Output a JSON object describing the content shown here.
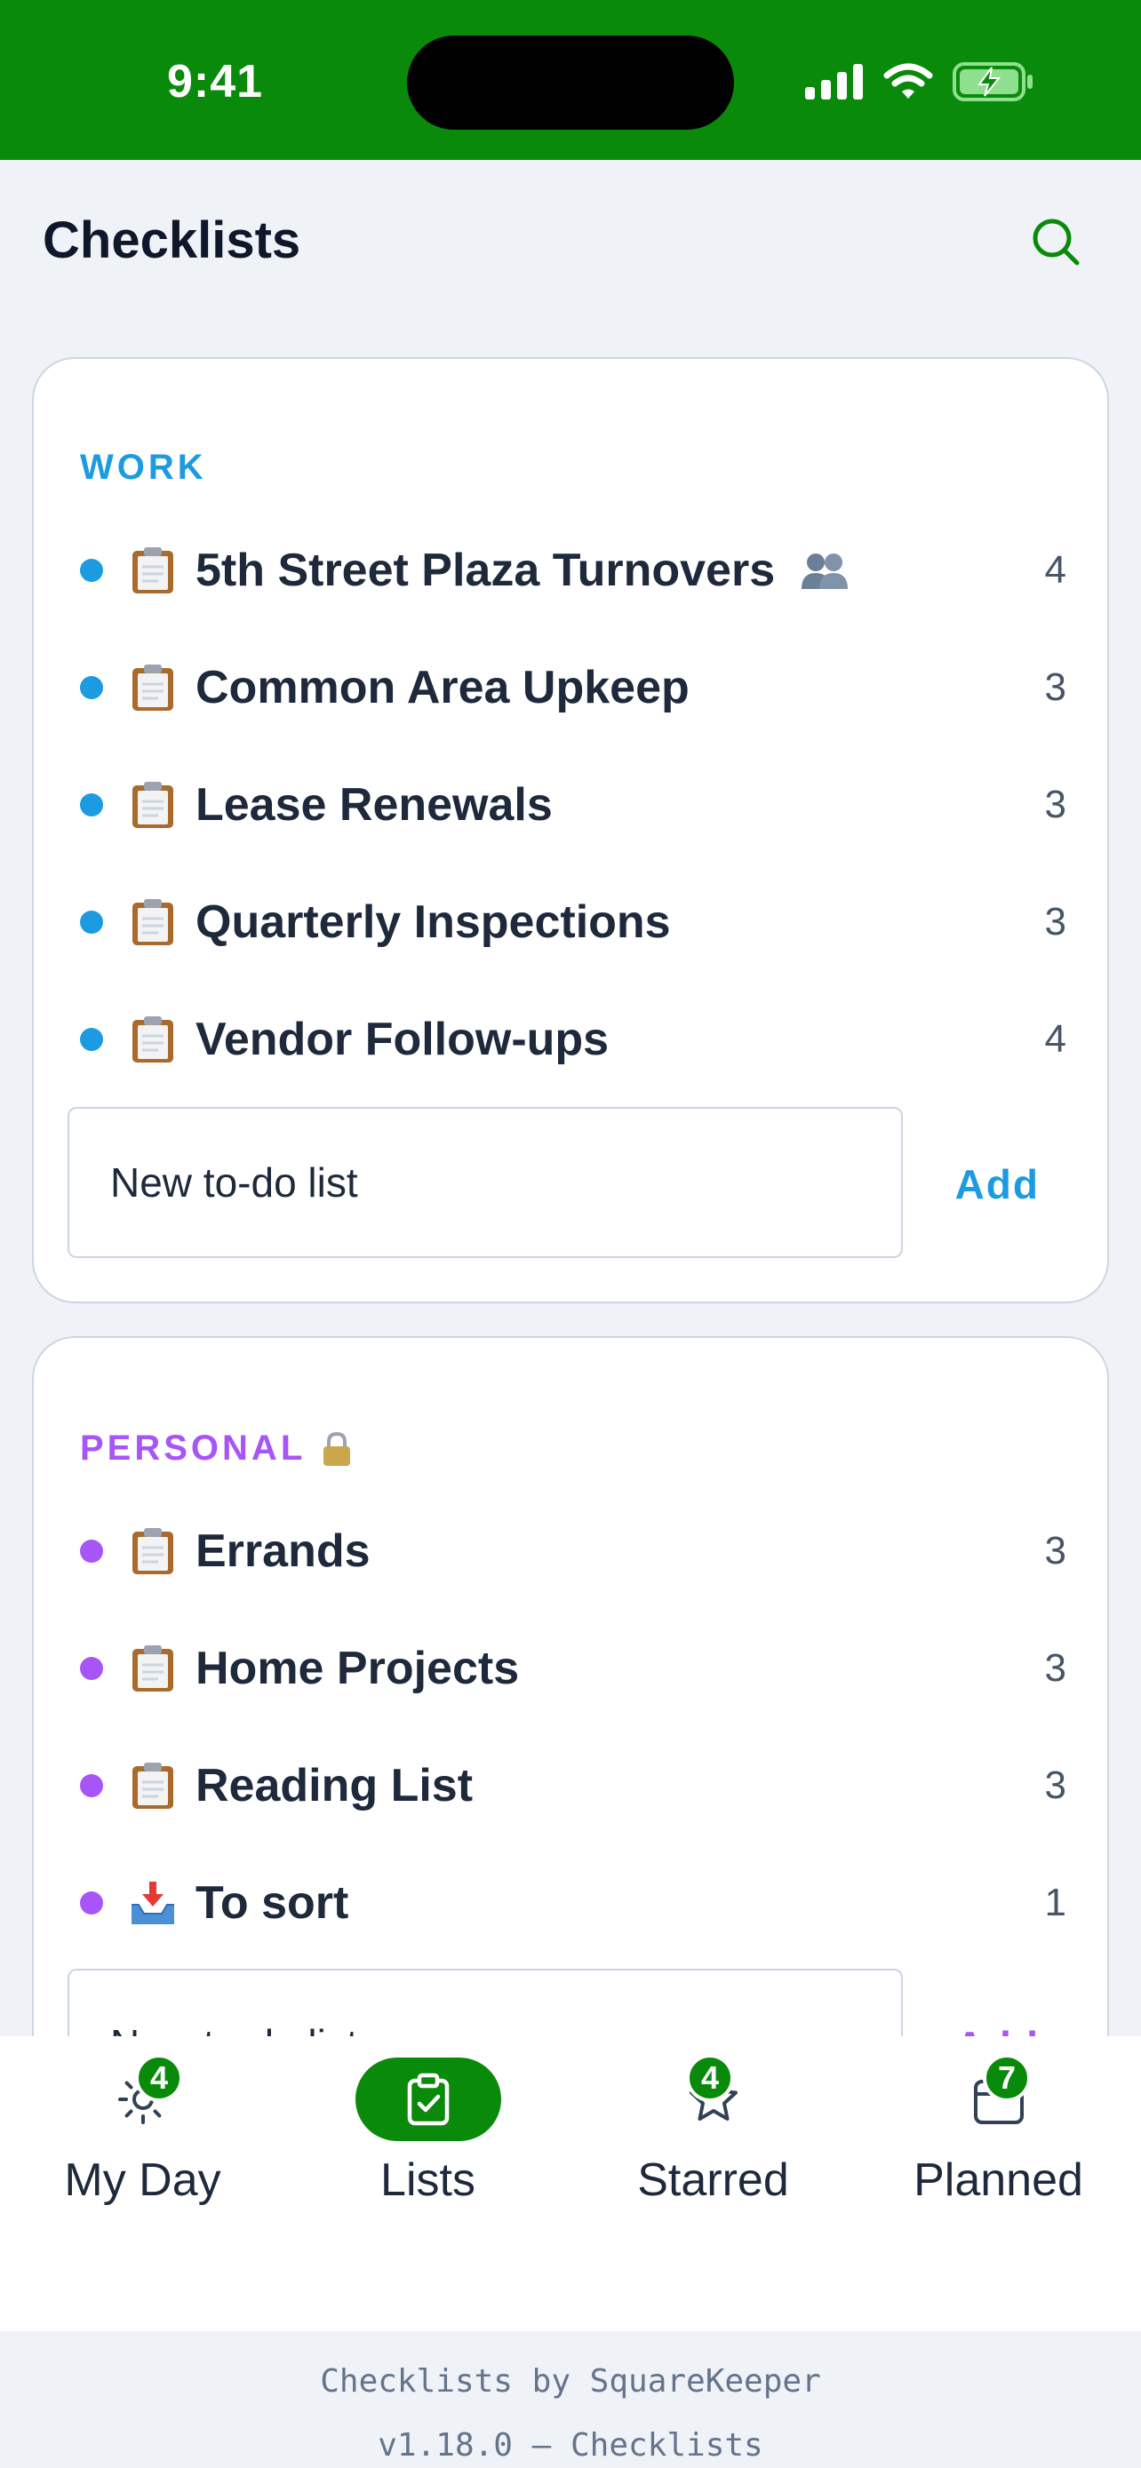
{
  "status_bar": {
    "time": "9:41",
    "icons": [
      "signal-icon",
      "wifi-icon",
      "battery-charging-icon"
    ],
    "background": "#0a8a0a"
  },
  "header": {
    "title": "Checklists",
    "search_icon": "search-icon"
  },
  "sections": {
    "work": {
      "label": "WORK",
      "color": "#1d9be0",
      "lists": [
        {
          "emoji": "clipboard-icon",
          "name": "5th Street Plaza Turnovers",
          "shared": true,
          "count": "4"
        },
        {
          "emoji": "clipboard-icon",
          "name": "Common Area Upkeep",
          "count": "3"
        },
        {
          "emoji": "clipboard-icon",
          "name": "Lease Renewals",
          "count": "3"
        },
        {
          "emoji": "clipboard-icon",
          "name": "Quarterly Inspections",
          "count": "3"
        },
        {
          "emoji": "clipboard-icon",
          "name": "Vendor Follow-ups",
          "count": "4"
        }
      ],
      "new_placeholder": "New to-do list",
      "add_label": "Add"
    },
    "personal": {
      "label": "PERSONAL",
      "locked": true,
      "color": "#a855f7",
      "lists": [
        {
          "emoji": "clipboard-icon",
          "name": "Errands",
          "count": "3"
        },
        {
          "emoji": "clipboard-icon",
          "name": "Home Projects",
          "count": "3"
        },
        {
          "emoji": "clipboard-icon",
          "name": "Reading List",
          "count": "3"
        },
        {
          "emoji": "inbox-tray-icon",
          "name": "To sort",
          "count": "1"
        }
      ],
      "new_placeholder": "New to-do list",
      "add_label": "Add"
    }
  },
  "tabbar": {
    "tabs": [
      {
        "label": "My Day",
        "icon": "sun-icon",
        "badge": "4",
        "active": false
      },
      {
        "label": "Lists",
        "icon": "clipboard-check-icon",
        "active": true
      },
      {
        "label": "Starred",
        "icon": "star-icon",
        "badge": "4",
        "active": false
      },
      {
        "label": "Planned",
        "icon": "calendar-plus-icon",
        "badge": "7",
        "active": false
      }
    ]
  },
  "footer": {
    "line1": "Checklists by SquareKeeper",
    "line2": "v1.18.0 — Checklists"
  }
}
